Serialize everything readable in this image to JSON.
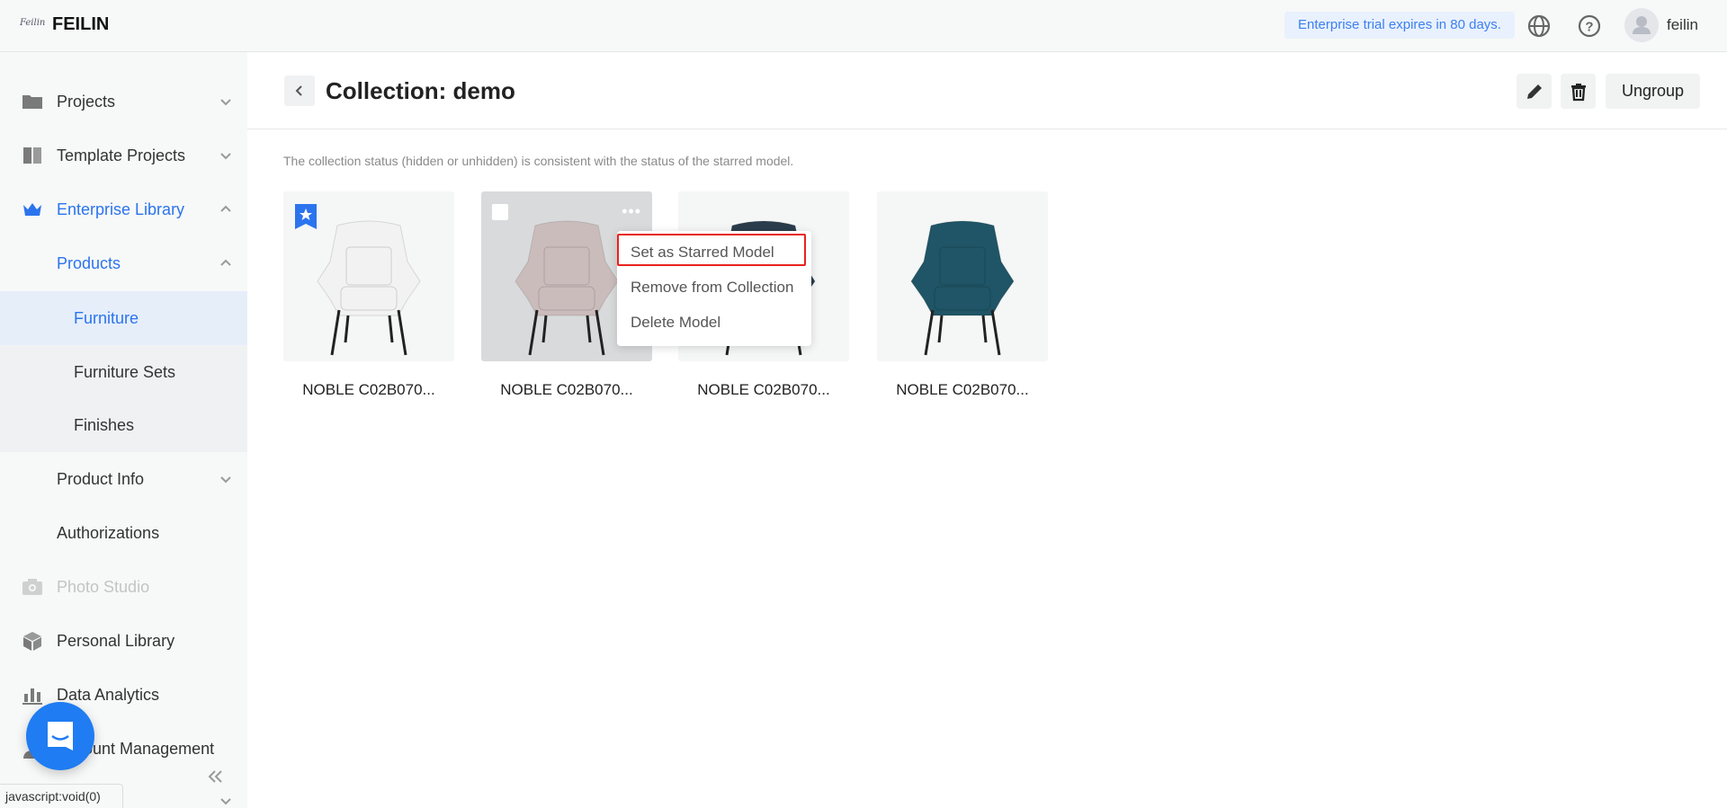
{
  "header": {
    "logo_mark": "Feilin",
    "brand": "FEILIN",
    "trial_notice": "Enterprise trial expires in 80 days.",
    "username": "feilin"
  },
  "sidebar": {
    "items": [
      {
        "label": "Projects",
        "icon": "folder-icon"
      },
      {
        "label": "Template Projects",
        "icon": "template-icon"
      },
      {
        "label": "Enterprise Library",
        "icon": "crown-icon"
      },
      {
        "label": "Products"
      },
      {
        "label": "Furniture"
      },
      {
        "label": "Furniture Sets"
      },
      {
        "label": "Finishes"
      },
      {
        "label": "Product Info"
      },
      {
        "label": "Authorizations"
      },
      {
        "label": "Photo Studio",
        "icon": "camera-icon"
      },
      {
        "label": "Personal Library",
        "icon": "cube-icon"
      },
      {
        "label": "Data Analytics",
        "icon": "bar-chart-icon"
      },
      {
        "label": "Account Management",
        "icon": "user-icon"
      }
    ]
  },
  "page": {
    "title": "Collection: demo",
    "ungroup_label": "Ungroup",
    "note": "The collection status (hidden or unhidden) is consistent with the status of the starred model."
  },
  "models": [
    {
      "name": "NOBLE C02B070...",
      "color": "#f2f2f2",
      "starred": true
    },
    {
      "name": "NOBLE C02B070...",
      "color": "#cbbcbc",
      "starred": false
    },
    {
      "name": "NOBLE C02B070...",
      "color": "#2b3d4c",
      "starred": false
    },
    {
      "name": "NOBLE C02B070...",
      "color": "#1f5566",
      "starred": false
    }
  ],
  "context_menu": {
    "items": [
      "Set as Starred Model",
      "Remove from Collection",
      "Delete Model"
    ]
  },
  "status_bar": "javascript:void(0)",
  "colors": {
    "accent": "#2b74ee",
    "highlight": "#e8231b"
  }
}
